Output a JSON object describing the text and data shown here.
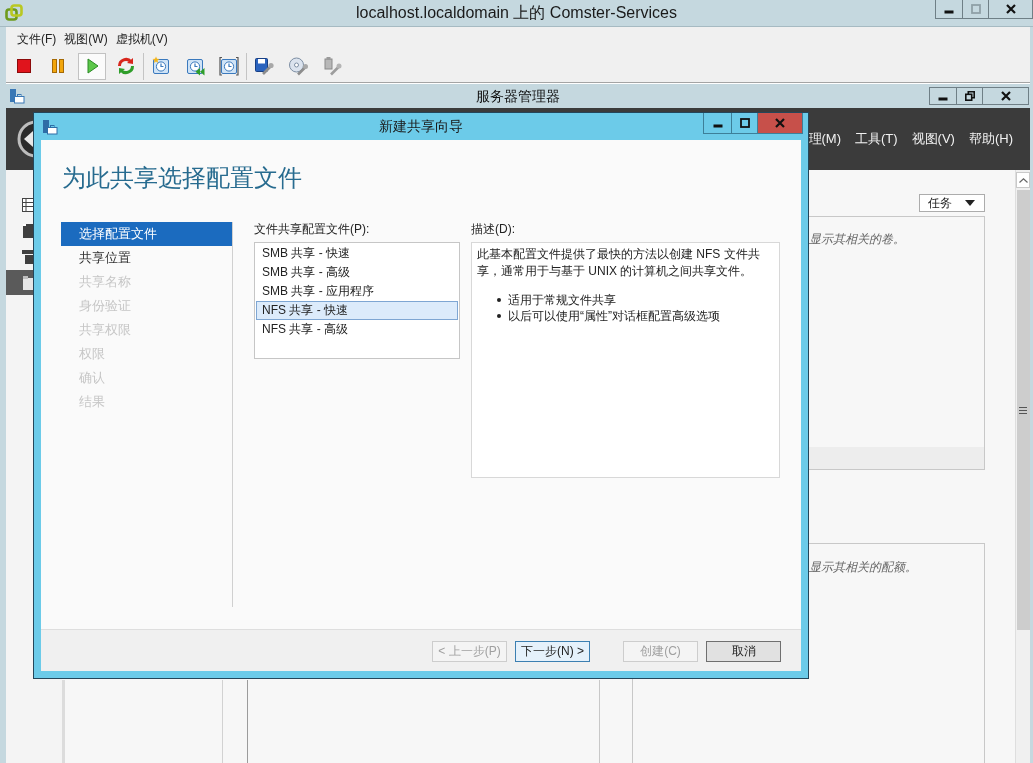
{
  "vm_window": {
    "title": "localhost.localdomain 上的 Comster-Services",
    "controls": [
      {
        "kind": "minimize",
        "disabled": false
      },
      {
        "kind": "maximize",
        "disabled": true
      },
      {
        "kind": "close",
        "disabled": false
      }
    ],
    "menu": [
      "文件(F)",
      "视图(W)",
      "虚拟机(V)"
    ],
    "toolbar": [
      [
        {
          "kind": "stop",
          "pressed": false
        },
        {
          "kind": "pause",
          "pressed": false
        },
        {
          "kind": "play",
          "pressed": true
        },
        {
          "kind": "reset",
          "pressed": false
        }
      ],
      [
        {
          "kind": "snapshot",
          "pressed": false
        },
        {
          "kind": "revert",
          "pressed": false
        },
        {
          "kind": "snapshots",
          "pressed": false
        }
      ],
      [
        {
          "kind": "disk",
          "pressed": false
        },
        {
          "kind": "cd",
          "pressed": false
        },
        {
          "kind": "usb",
          "pressed": false
        }
      ]
    ]
  },
  "server_manager": {
    "title": "服务器管理器",
    "controls": [
      {
        "kind": "minimize",
        "disabled": false
      },
      {
        "kind": "restore",
        "disabled": false
      },
      {
        "kind": "close",
        "disabled": false
      }
    ],
    "menu": [
      "理(M)",
      "工具(T)",
      "视图(V)",
      "帮助(H)"
    ],
    "sidebar": [
      {
        "kind": "dashboard",
        "selected": false
      },
      {
        "kind": "server",
        "selected": false
      },
      {
        "kind": "servers",
        "selected": false
      },
      {
        "kind": "files",
        "selected": true
      }
    ],
    "tasks_button": "任务",
    "panels": [
      {
        "hint": "显示其相关的卷。"
      },
      {
        "hint": "显示其相关的配额。"
      }
    ]
  },
  "dialog": {
    "title": "新建共享向导",
    "controls": [
      {
        "kind": "minimize",
        "disabled": false
      },
      {
        "kind": "maximize",
        "disabled": false
      },
      {
        "kind": "close",
        "disabled": false
      }
    ],
    "heading": "为此共享选择配置文件",
    "steps": [
      {
        "label": "选择配置文件",
        "selected": true,
        "disabled": false
      },
      {
        "label": "共享位置",
        "selected": false,
        "disabled": false
      },
      {
        "label": "共享名称",
        "selected": false,
        "disabled": true
      },
      {
        "label": "身份验证",
        "selected": false,
        "disabled": true
      },
      {
        "label": "共享权限",
        "selected": false,
        "disabled": true
      },
      {
        "label": "权限",
        "selected": false,
        "disabled": true
      },
      {
        "label": "确认",
        "selected": false,
        "disabled": true
      },
      {
        "label": "结果",
        "selected": false,
        "disabled": true
      }
    ],
    "profiles": {
      "label": "文件共享配置文件(P):",
      "items": [
        {
          "label": "SMB 共享 - 快速",
          "selected": false
        },
        {
          "label": "SMB 共享 - 高级",
          "selected": false
        },
        {
          "label": "SMB 共享 - 应用程序",
          "selected": false
        },
        {
          "label": "NFS 共享 - 快速",
          "selected": true
        },
        {
          "label": "NFS 共享 - 高级",
          "selected": false
        }
      ]
    },
    "description": {
      "label": "描述(D):",
      "text": "此基本配置文件提供了最快的方法以创建 NFS 文件共享，通常用于与基于 UNIX 的计算机之间共享文件。",
      "bullets": [
        "适用于常规文件共享",
        "以后可以使用“属性”对话框配置高级选项"
      ]
    },
    "nav_buttons": [
      {
        "label": "< 上一步(P)",
        "disabled": true,
        "default": false
      },
      {
        "label": "下一步(N) >",
        "disabled": false,
        "default": true
      }
    ],
    "action_buttons": [
      {
        "label": "创建(C)",
        "disabled": true,
        "default": false
      },
      {
        "label": "取消",
        "disabled": false,
        "default": false
      }
    ]
  }
}
